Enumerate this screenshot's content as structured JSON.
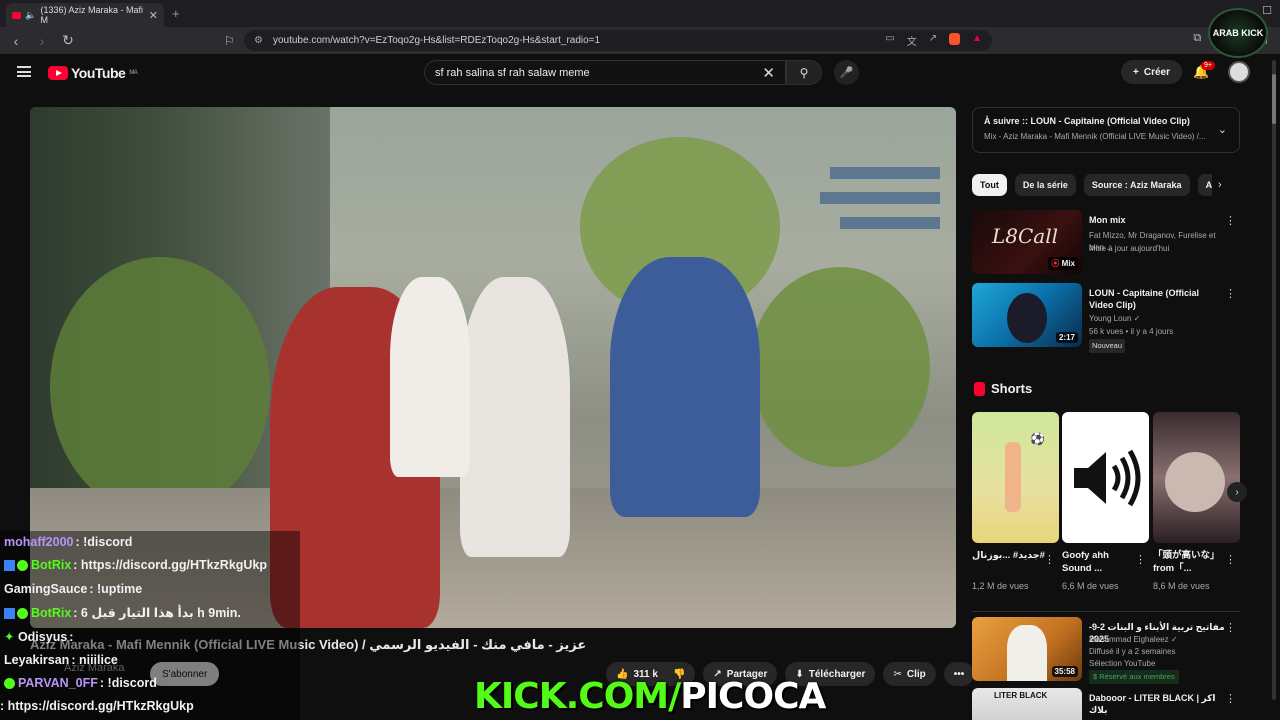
{
  "browser": {
    "tab_title": "(1336) Aziz Maraka - Mafi M",
    "url": "youtube.com/watch?v=EzToqo2g-Hs&list=RDEzToqo2g-Hs&start_radio=1"
  },
  "overlay_logo": {
    "text": "ARAB KICK"
  },
  "header": {
    "logo_text": "YouTube",
    "logo_region": "MA",
    "search_value": "sf rah salina sf rah salaw meme",
    "create_label": "Créer",
    "notif_count": "9+"
  },
  "video": {
    "title": "Aziz Maraka - Mafi Mennik (Official LIVE Music Video) / عزيز - مافي منك - الفيديو الرسمي",
    "channel": "Aziz Maraka",
    "subscribe_label": "S'abonner",
    "likes": "311 k",
    "share_label": "Partager",
    "download_label": "Télécharger",
    "clip_label": "Clip"
  },
  "stream_overlay": {
    "kick_green": "KICK.COM/",
    "kick_white": "PICOCA",
    "chat": [
      {
        "user": "mohaff2000",
        "text": ": !discord",
        "color": "#b794f6",
        "icon": ""
      },
      {
        "user": "BotRix",
        "text": ": https://discord.gg/HTkzRkgUkp",
        "color": "#53fc18",
        "icon": "bot"
      },
      {
        "user": "GamingSauce",
        "text": ": !uptime",
        "color": "#ffffff",
        "icon": ""
      },
      {
        "user": "BotRix",
        "text": ": 6 بدأ هذا التيار قبل h 9min.",
        "color": "#53fc18",
        "icon": "bot"
      },
      {
        "user": "Odisyus",
        "text": ":",
        "color": "#ffffff",
        "icon": "diamond"
      },
      {
        "user": "Leyakirsan",
        "text": ": niiilice",
        "color": "#ffffff",
        "icon": ""
      },
      {
        "user": "PARVAN_0FF",
        "text": ": !discord",
        "color": "#b794f6",
        "icon": "check"
      },
      {
        "user": "",
        "text": ": https://discord.gg/HTkzRkgUkp",
        "color": "#ffffff",
        "icon": ""
      }
    ]
  },
  "sidebar": {
    "up_next_title": "À suivre :: LOUN - Capitaine (Official Video Clip)",
    "up_next_sub": "Mix - Aziz Maraka - Mafi Mennik (Official LIVE Music Video) /...",
    "chips": [
      "Tout",
      "De la série",
      "Source : Aziz Maraka",
      "Au"
    ],
    "items": [
      {
        "title": "Mon mix",
        "meta1": "Fat Mizzo, Mr Draganov, Furelise et bien ...",
        "meta2": "Mise à jour aujourd'hui",
        "badge": "Mix"
      },
      {
        "title": "LOUN - Capitaine (Official Video Clip)",
        "meta1": "Young Loun",
        "meta2": "56 k vues • il y a 4 jours",
        "duration": "2:17",
        "tag": "Nouveau"
      }
    ],
    "shorts_heading": "Shorts",
    "shorts": [
      {
        "title": "جديد# ...بوزنال#",
        "views": "1,2 M de vues"
      },
      {
        "title": "Goofy ahh Sound ...",
        "views": "6,6 M de vues"
      },
      {
        "title": "「頭が高いな」from「...",
        "views": "8,6 M de vues"
      }
    ],
    "bottom_items": [
      {
        "title": "مفاتيح تربية الأبناء و البنات 2-9-2025",
        "meta1": "Mohammad Elghaleez",
        "meta2": "Diffusé il y a 2 semaines",
        "meta3": "Sélection YouTube",
        "member": "Réservé aux membres",
        "duration": "35:58"
      },
      {
        "title": "Dabooor - LITER BLACK | اكر بلاك",
        "thumb_text": "LITER BLACK"
      }
    ]
  }
}
